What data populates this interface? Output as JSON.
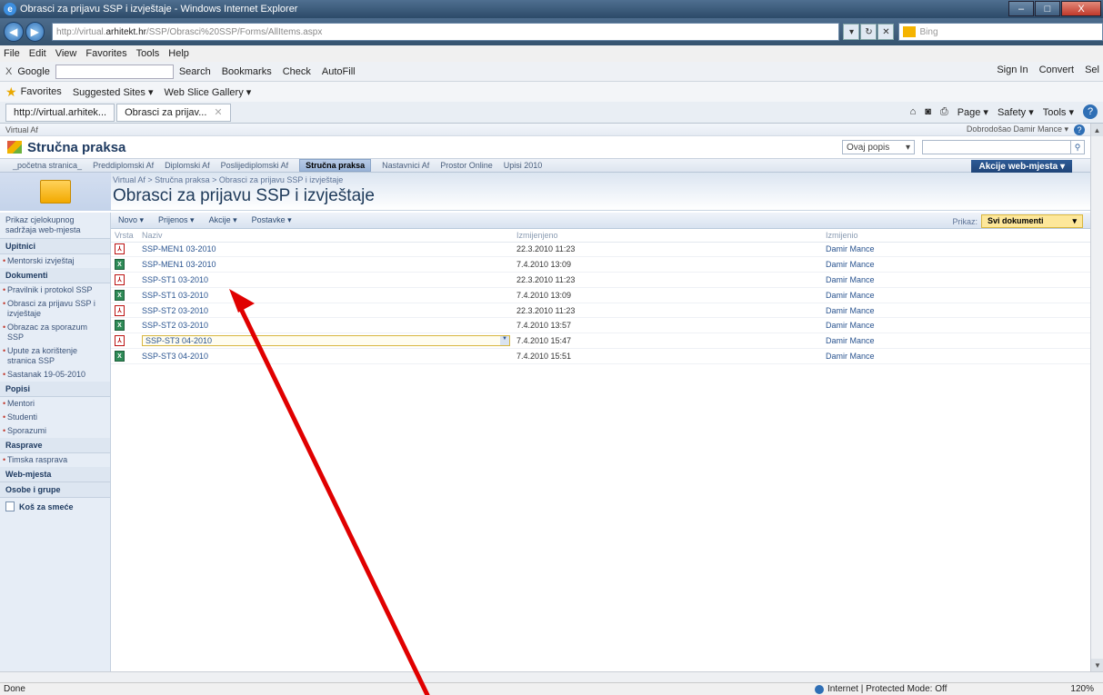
{
  "window": {
    "title": "Obrasci za prijavu SSP i izvještaje - Windows Internet Explorer",
    "minimize": "–",
    "maximize": "□",
    "close": "X"
  },
  "address": {
    "prefix": "http://virtual.",
    "domain": "arhitekt.hr",
    "path": "/SSP/Obrasci%20SSP/Forms/AllItems.aspx",
    "search_placeholder": "Bing"
  },
  "menu": [
    "File",
    "Edit",
    "View",
    "Favorites",
    "Tools",
    "Help"
  ],
  "googlebar": {
    "x": "X",
    "logo": "Google",
    "search": "Search",
    "bookmarks": "Bookmarks",
    "check": "Check",
    "autofill": "AutoFill",
    "signin": "Sign In",
    "convert": "Convert",
    "select": "Sel"
  },
  "favorites": {
    "label": "Favorites",
    "suggested": "Suggested Sites ▾",
    "webslice": "Web Slice Gallery ▾"
  },
  "tabs": [
    {
      "label": "http://virtual.arhitek..."
    },
    {
      "label": "Obrasci za prijav..."
    }
  ],
  "commandbar": {
    "page": "Page ▾",
    "safety": "Safety ▾",
    "tools": "Tools ▾"
  },
  "sp": {
    "site_root": "Virtual Af",
    "welcome": "Dobrodošao Damir Mance ▾",
    "site_name": "Stručna praksa",
    "search_scope": "Ovaj popis",
    "topnav": [
      "_početna stranica_",
      "Preddiplomski Af",
      "Diplomski Af",
      "Poslijediplomski Af",
      "Stručna praksa",
      "Nastavnici Af",
      "Prostor Online",
      "Upisi 2010"
    ],
    "site_actions": "Akcije web-mjesta ▾",
    "breadcrumb": "Virtual Af > Stručna praksa > Obrasci za prijavu SSP i izvještaje",
    "page_title": "Obrasci za prijavu SSP i izvještaje",
    "quicklaunch": {
      "view_all": "Prikaz cjelokupnog sadržaja web-mjesta",
      "upitnici": "Upitnici",
      "upitnici_items": [
        "Mentorski izvještaj"
      ],
      "dokumenti": "Dokumenti",
      "dokumenti_items": [
        "Pravilnik i protokol SSP",
        "Obrasci za prijavu SSP i izvještaje",
        "Obrazac za sporazum SSP",
        "Upute za korištenje stranica SSP",
        "Sastanak 19-05-2010"
      ],
      "popisi": "Popisi",
      "popisi_items": [
        "Mentori",
        "Studenti",
        "Sporazumi"
      ],
      "rasprave": "Rasprave",
      "rasprave_items": [
        "Timska rasprava"
      ],
      "web_mjesta": "Web-mjesta",
      "osobe": "Osobe i grupe",
      "trash": "Koš za smeće"
    },
    "toolbar": {
      "new": "Novo ▾",
      "upload": "Prijenos ▾",
      "actions": "Akcije ▾",
      "settings": "Postavke ▾",
      "view_label": "Prikaz:",
      "view_value": "Svi dokumenti"
    },
    "columns": {
      "type": "Vrsta",
      "name": "Naziv",
      "modified": "Izmijenjeno",
      "modified_by": "Izmijenio"
    },
    "rows": [
      {
        "type": "pdf",
        "name": "SSP-MEN1 03-2010",
        "modified": "22.3.2010 11:23",
        "by": "Damir Mance"
      },
      {
        "type": "xls",
        "name": "SSP-MEN1 03-2010",
        "modified": "7.4.2010 13:09",
        "by": "Damir Mance"
      },
      {
        "type": "pdf",
        "name": "SSP-ST1 03-2010",
        "modified": "22.3.2010 11:23",
        "by": "Damir Mance"
      },
      {
        "type": "xls",
        "name": "SSP-ST1 03-2010",
        "modified": "7.4.2010 13:09",
        "by": "Damir Mance"
      },
      {
        "type": "pdf",
        "name": "SSP-ST2 03-2010",
        "modified": "22.3.2010 11:23",
        "by": "Damir Mance"
      },
      {
        "type": "xls",
        "name": "SSP-ST2 03-2010",
        "modified": "7.4.2010 13:57",
        "by": "Damir Mance"
      },
      {
        "type": "pdf",
        "name": "SSP-ST3 04-2010",
        "modified": "7.4.2010 15:47",
        "by": "Damir Mance",
        "selected": true
      },
      {
        "type": "xls",
        "name": "SSP-ST3 04-2010",
        "modified": "7.4.2010 15:51",
        "by": "Damir Mance"
      }
    ]
  },
  "status": {
    "left": "Done",
    "zone": "Internet | Protected Mode: Off",
    "zoom": "120%"
  },
  "colors": {
    "annotation_arrow": "#e00000",
    "sp_blue": "#2a5490"
  }
}
